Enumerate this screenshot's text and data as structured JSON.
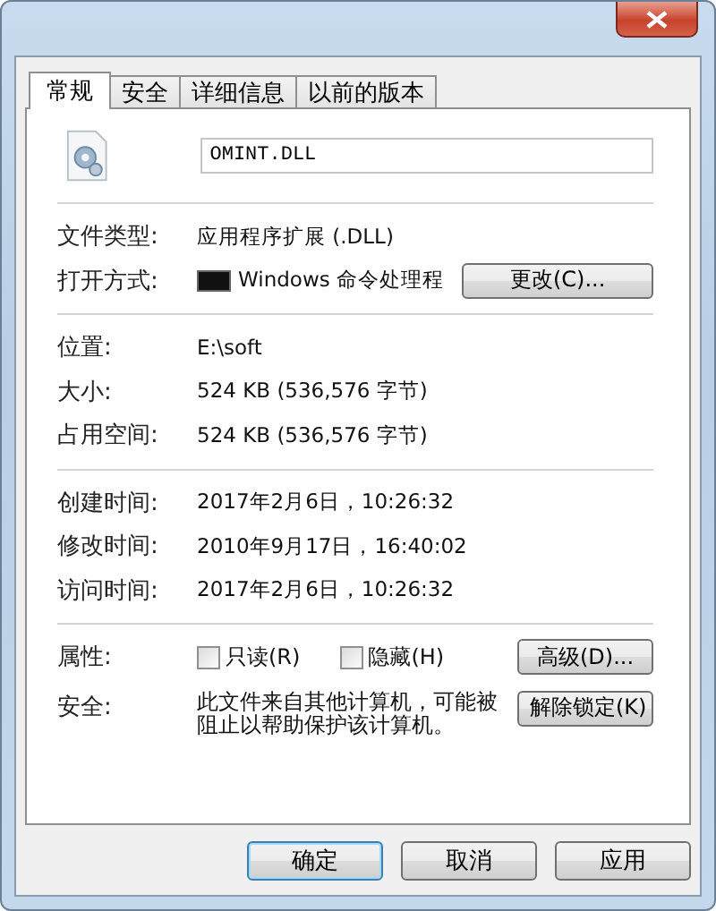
{
  "tabs": [
    {
      "label": "常规",
      "selected": true
    },
    {
      "label": "安全",
      "selected": false
    },
    {
      "label": "详细信息",
      "selected": false
    },
    {
      "label": "以前的版本",
      "selected": false
    }
  ],
  "file_name": {
    "value": "OMINT.DLL"
  },
  "sections": [
    {
      "rows": [
        {
          "label": "文件类型:",
          "value": "应用程序扩展 (.DLL)"
        },
        {
          "label": "打开方式:",
          "value": "Windows 命令处理程",
          "kind": "app",
          "button": "更改(C)..."
        }
      ]
    },
    {
      "rows": [
        {
          "label": "位置:",
          "value": "E:\\soft"
        },
        {
          "label": "大小:",
          "value": "524 KB (536,576 字节)"
        },
        {
          "label": "占用空间:",
          "value": "524 KB (536,576 字节)"
        }
      ]
    },
    {
      "rows": [
        {
          "label": "创建时间:",
          "value": "2017年2月6日，10:26:32"
        },
        {
          "label": "修改时间:",
          "value": "2010年9月17日，16:40:02"
        },
        {
          "label": "访问时间:",
          "value": "2017年2月6日，10:26:32"
        }
      ]
    }
  ],
  "attributes": {
    "label": "属性:",
    "checkboxes": [
      {
        "label": "只读(R)",
        "checked": false
      },
      {
        "label": "隐藏(H)",
        "checked": false
      }
    ],
    "button": "高级(D)..."
  },
  "security": {
    "label": "安全:",
    "text": "此文件来自其他计算机，可能被阻止以帮助保护该计算机。",
    "button": "解除锁定(K)"
  },
  "buttons": [
    "确定",
    "取消",
    "应用"
  ]
}
